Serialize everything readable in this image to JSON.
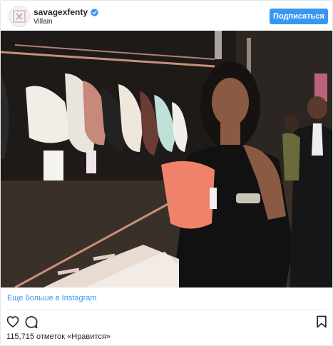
{
  "post": {
    "username": "savagexfenty",
    "location": "Villain",
    "follow_label": "Подписаться",
    "more_link": "Еще больше в Instagram",
    "likes_text": "115,715 отметок «Нравится»",
    "photo_alt": "Photo"
  },
  "icons": {
    "verified": "verified-badge-icon",
    "like": "heart-icon",
    "comment": "comment-bubble-icon",
    "save": "bookmark-icon"
  },
  "colors": {
    "accent": "#3897f0",
    "text": "#262626",
    "border": "#e6e6e6"
  }
}
